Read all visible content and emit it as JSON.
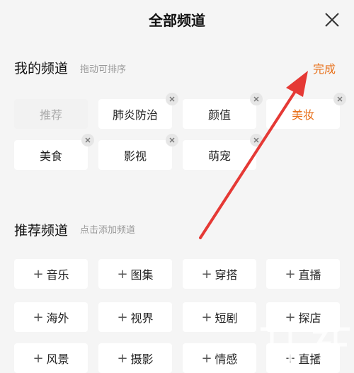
{
  "header": {
    "title": "全部频道"
  },
  "my_channels": {
    "title": "我的频道",
    "hint": "拖动可排序",
    "done_label": "完成",
    "items": [
      {
        "label": "推荐"
      },
      {
        "label": "肺炎防治"
      },
      {
        "label": "颜值"
      },
      {
        "label": "美妆"
      },
      {
        "label": "美食"
      },
      {
        "label": "影视"
      },
      {
        "label": "萌宠"
      }
    ]
  },
  "recommended_channels": {
    "title": "推荐频道",
    "hint": "点击添加频道",
    "items": [
      {
        "label": "音乐"
      },
      {
        "label": "图集"
      },
      {
        "label": "穿搭"
      },
      {
        "label": "直播"
      },
      {
        "label": "海外"
      },
      {
        "label": "视界"
      },
      {
        "label": "短剧"
      },
      {
        "label": "探店"
      },
      {
        "label": "风景"
      },
      {
        "label": "摄影"
      },
      {
        "label": "情感"
      },
      {
        "label": "直播"
      }
    ]
  },
  "colors": {
    "accent": "#e8711b",
    "arrow": "#e53935",
    "background": "#f5f5f5"
  }
}
